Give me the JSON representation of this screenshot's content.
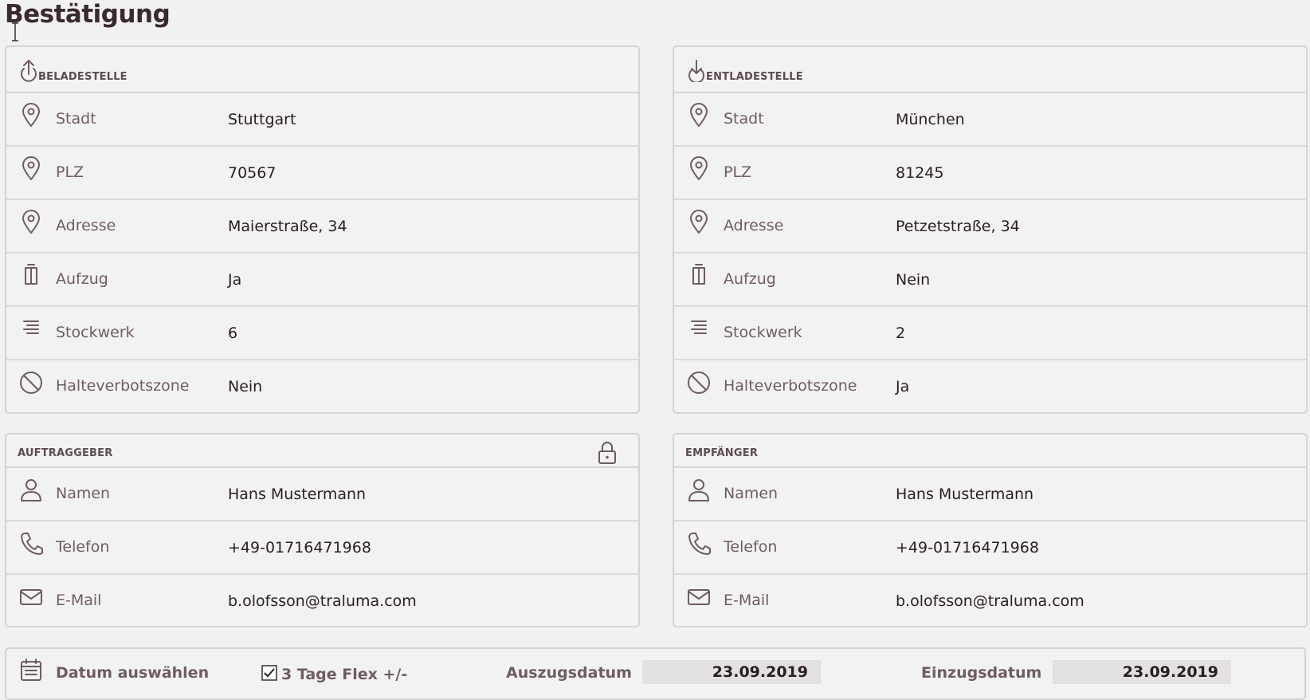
{
  "page": {
    "title": "Bestätigung"
  },
  "loading": {
    "title": "BELADESTELLE",
    "rows": [
      {
        "label": "Stadt",
        "value": "Stuttgart"
      },
      {
        "label": "PLZ",
        "value": "70567"
      },
      {
        "label": "Adresse",
        "value": "Maierstraße, 34"
      },
      {
        "label": "Aufzug",
        "value": "Ja"
      },
      {
        "label": "Stockwerk",
        "value": "6"
      },
      {
        "label": "Halteverbotszone",
        "value": "Nein"
      }
    ]
  },
  "unloading": {
    "title": "ENTLADESTELLE",
    "rows": [
      {
        "label": "Stadt",
        "value": "München"
      },
      {
        "label": "PLZ",
        "value": "81245"
      },
      {
        "label": "Adresse",
        "value": "Petzetstraße, 34"
      },
      {
        "label": "Aufzug",
        "value": "Nein"
      },
      {
        "label": "Stockwerk",
        "value": "2"
      },
      {
        "label": "Halteverbotszone",
        "value": "Ja"
      }
    ]
  },
  "client": {
    "title": "AUFTRAGGEBER",
    "rows": [
      {
        "label": "Namen",
        "value": "Hans Mustermann"
      },
      {
        "label": "Telefon",
        "value": "+49-01716471968"
      },
      {
        "label": "E-Mail",
        "value": "b.olofsson@traluma.com"
      }
    ]
  },
  "recipient": {
    "title": "EMPFÄNGER",
    "rows": [
      {
        "label": "Namen",
        "value": "Hans Mustermann"
      },
      {
        "label": "Telefon",
        "value": "+49-01716471968"
      },
      {
        "label": "E-Mail",
        "value": "b.olofsson@traluma.com"
      }
    ]
  },
  "dates": {
    "select_label": "Datum auswählen",
    "flex_label": "3 Tage Flex +/-",
    "flex_checked": true,
    "moveout_label": "Auszugsdatum",
    "moveout_value": "23.09.2019",
    "movein_label": "Einzugsdatum",
    "movein_value": "23.09.2019"
  },
  "icons": {
    "loading": "upload-arrow-icon",
    "unloading": "download-arrow-icon",
    "location": "map-pin-icon",
    "elevator": "elevator-icon",
    "floor": "list-lines-icon",
    "no_parking": "prohibited-icon",
    "person": "person-icon",
    "phone": "phone-icon",
    "mail": "envelope-icon",
    "lock": "lock-icon",
    "calendar": "calendar-icon"
  },
  "colors": {
    "background": "#f2f1f1",
    "border": "#d6d3d3",
    "label": "#6e5c63",
    "value": "#2a1e22",
    "field": "#e3e0e0"
  }
}
